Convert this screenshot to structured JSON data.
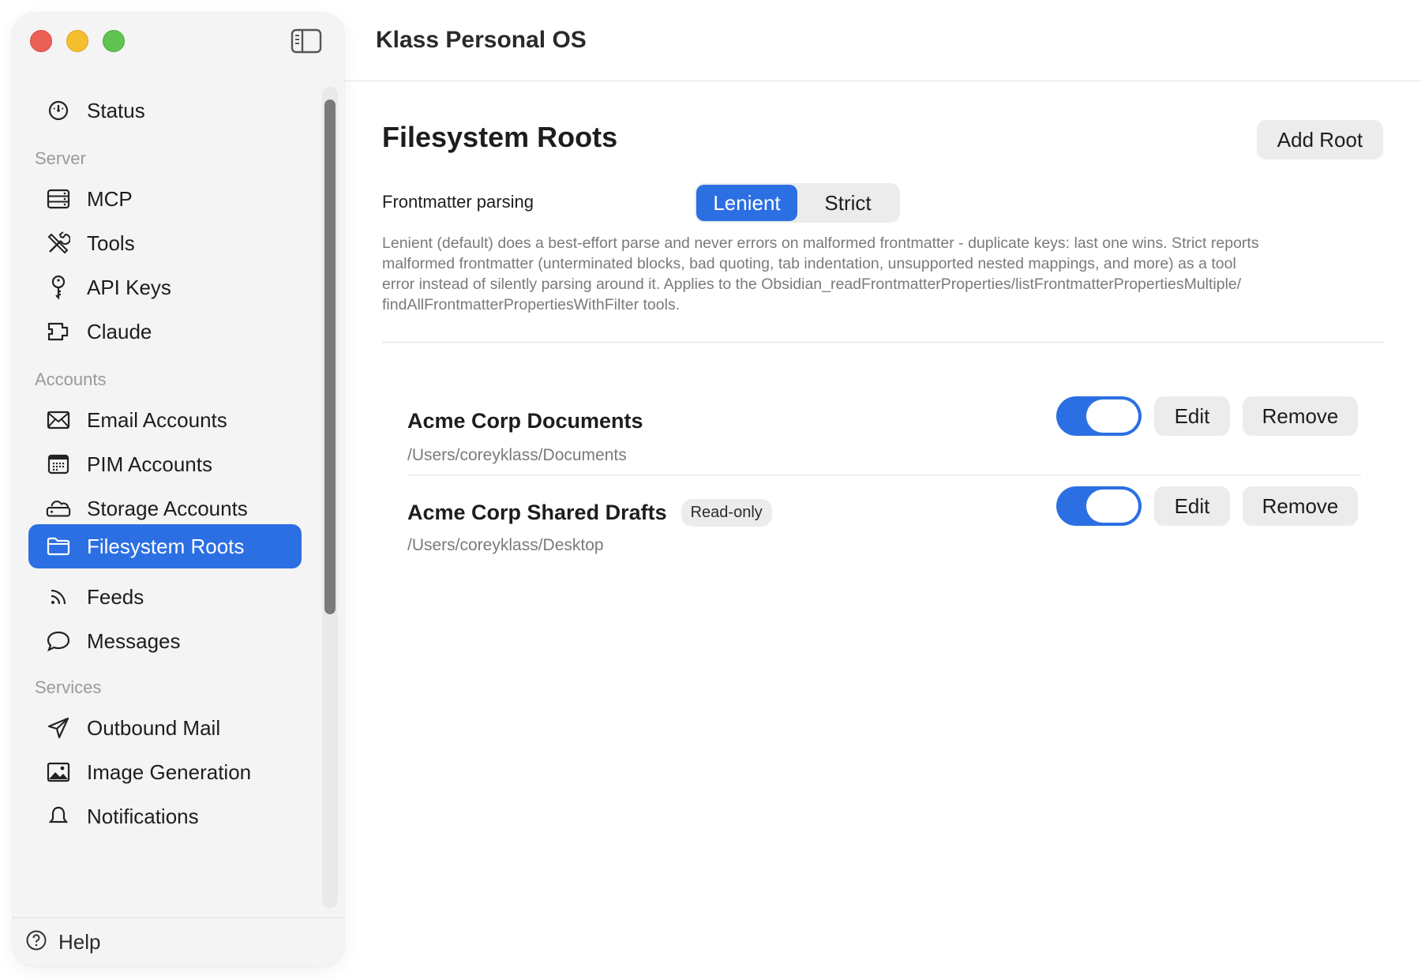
{
  "window": {
    "title": "Klass Personal OS"
  },
  "sidebar": {
    "status_label": "Status",
    "sections": {
      "server": "Server",
      "accounts": "Accounts",
      "services": "Services"
    },
    "server_items": [
      {
        "label": "MCP",
        "icon": "server-icon"
      },
      {
        "label": "Tools",
        "icon": "tools-icon"
      },
      {
        "label": "API Keys",
        "icon": "key-icon"
      },
      {
        "label": "Claude",
        "icon": "plugin-icon"
      }
    ],
    "account_items": [
      {
        "label": "Email Accounts",
        "icon": "envelope-icon"
      },
      {
        "label": "PIM Accounts",
        "icon": "calendar-icon"
      },
      {
        "label": "Storage Accounts",
        "icon": "cloud-drive-icon"
      },
      {
        "label": "Filesystem Roots",
        "icon": "folder-icon",
        "active": true
      },
      {
        "label": "Feeds",
        "icon": "rss-icon"
      },
      {
        "label": "Messages",
        "icon": "chat-bubble-icon"
      }
    ],
    "service_items": [
      {
        "label": "Outbound Mail",
        "icon": "paper-plane-icon"
      },
      {
        "label": "Image Generation",
        "icon": "photo-icon"
      },
      {
        "label": "Notifications",
        "icon": "bell-icon"
      }
    ],
    "help_label": "Help"
  },
  "main": {
    "page_title": "Filesystem Roots",
    "add_root_label": "Add Root",
    "frontmatter": {
      "label": "Frontmatter parsing",
      "options": [
        "Lenient",
        "Strict"
      ],
      "selected": "Lenient",
      "description_lines": [
        "Lenient (default) does a best-effort parse and never errors on malformed frontmatter - duplicate keys: last one wins. Strict reports",
        "malformed frontmatter (unterminated blocks, bad quoting, tab indentation, unsupported nested mappings, and more) as a tool",
        "error instead of silently parsing around it. Applies to the Obsidian_readFrontmatterProperties/listFrontmatterPropertiesMultiple/",
        "findAllFrontmatterPropertiesWithFilter tools."
      ]
    },
    "roots": [
      {
        "name": "Acme Corp Documents",
        "path": "/Users/coreyklass/Documents",
        "badge": "",
        "enabled": true
      },
      {
        "name": "Acme Corp Shared Drafts",
        "path": "/Users/coreyklass/Desktop",
        "badge": "Read-only",
        "enabled": true
      }
    ],
    "edit_label": "Edit",
    "remove_label": "Remove"
  },
  "colors": {
    "accent": "#2c6fe3",
    "close": "#ec5f57",
    "minimize": "#f4be2f",
    "zoom": "#5fc450"
  }
}
